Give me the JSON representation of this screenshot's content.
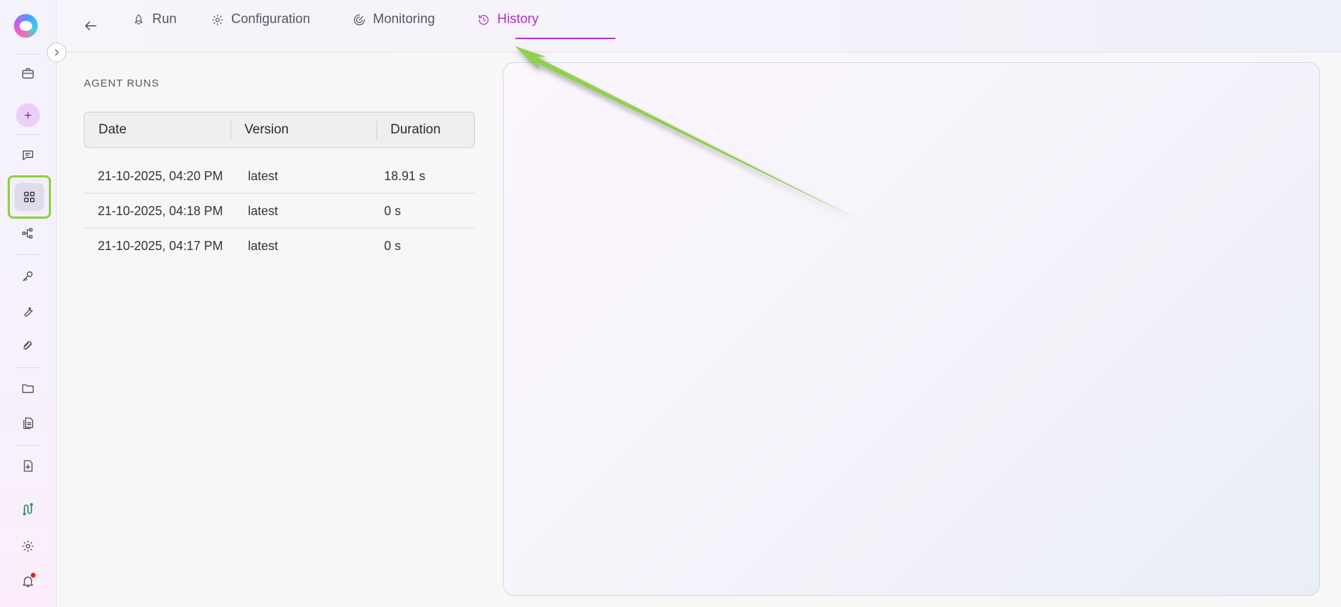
{
  "tabs": [
    {
      "label": "Run",
      "icon": "rocket-icon",
      "active": false
    },
    {
      "label": "Configuration",
      "icon": "gear-icon",
      "active": false
    },
    {
      "label": "Monitoring",
      "icon": "monitoring-icon",
      "active": false
    },
    {
      "label": "History",
      "icon": "history-icon",
      "active": true
    }
  ],
  "agent_runs": {
    "title": "AGENT RUNS",
    "columns": [
      "Date",
      "Version",
      "Duration"
    ],
    "rows": [
      {
        "date": "21-10-2025, 04:20 PM",
        "version": "latest",
        "duration": "18.91 s"
      },
      {
        "date": "21-10-2025, 04:18 PM",
        "version": "latest",
        "duration": "0 s"
      },
      {
        "date": "21-10-2025, 04:17 PM",
        "version": "latest",
        "duration": "0 s"
      }
    ]
  },
  "sidebar": {
    "items": [
      {
        "icon": "briefcase-icon"
      },
      {
        "icon": "plus-icon"
      },
      {
        "icon": "chat-icon"
      },
      {
        "icon": "grid-icon",
        "active": true
      },
      {
        "icon": "workflow-icon"
      },
      {
        "icon": "key-icon"
      },
      {
        "icon": "wrench-icon"
      },
      {
        "icon": "paperclip-icon"
      },
      {
        "icon": "folder-icon"
      },
      {
        "icon": "documents-icon"
      },
      {
        "icon": "download-file-icon"
      },
      {
        "icon": "integration-icon"
      },
      {
        "icon": "settings-icon"
      },
      {
        "icon": "bell-icon",
        "has_notification": true
      }
    ]
  },
  "colors": {
    "accent": "#b02fc4",
    "highlight_green": "#8dcf3f",
    "notification": "#e0202a"
  }
}
